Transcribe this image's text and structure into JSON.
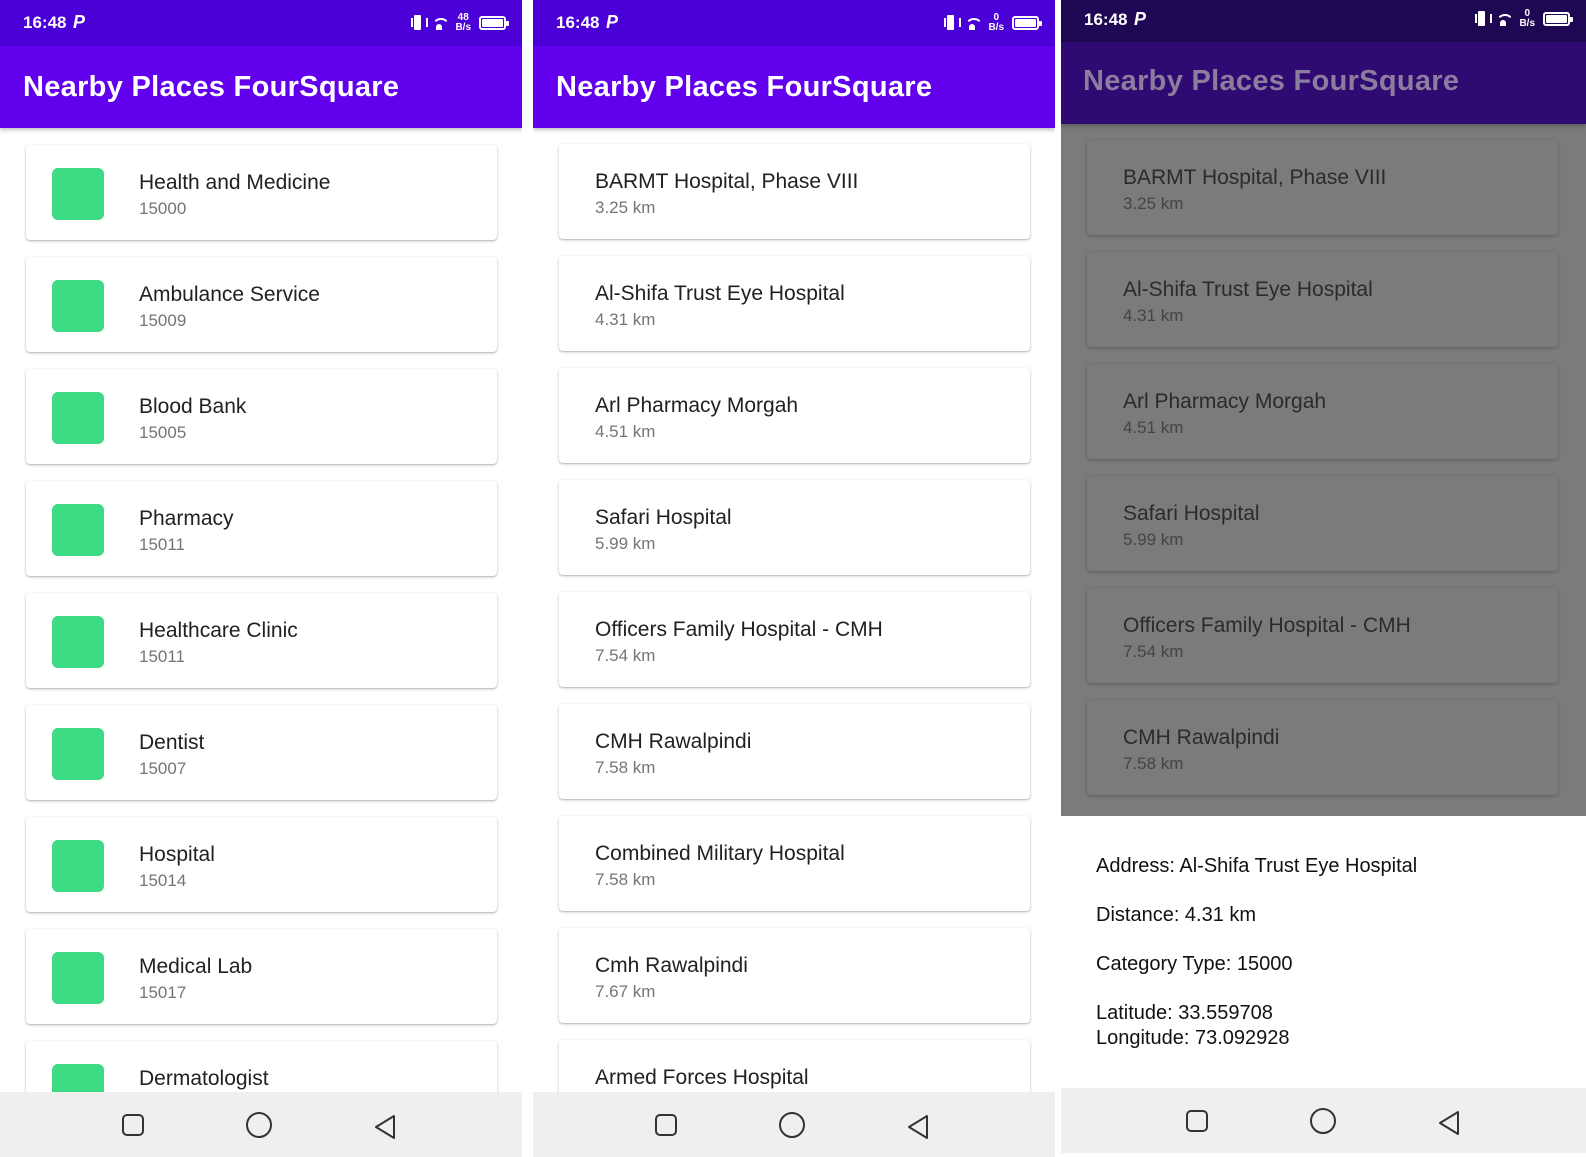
{
  "status_bar": {
    "time": "16:48",
    "carrier_glyph": "P",
    "screens": [
      {
        "net_top": "48",
        "net_bottom": "B/s"
      },
      {
        "net_top": "0",
        "net_bottom": "B/s"
      },
      {
        "net_top": "0",
        "net_bottom": "B/s"
      }
    ]
  },
  "app_title": "Nearby Places FourSquare",
  "categories": [
    {
      "name": "Health and Medicine",
      "code": "15000"
    },
    {
      "name": "Ambulance Service",
      "code": "15009"
    },
    {
      "name": "Blood Bank",
      "code": "15005"
    },
    {
      "name": "Pharmacy",
      "code": "15011"
    },
    {
      "name": "Healthcare Clinic",
      "code": "15011"
    },
    {
      "name": "Dentist",
      "code": "15007"
    },
    {
      "name": "Hospital",
      "code": "15014"
    },
    {
      "name": "Medical Lab",
      "code": "15017"
    },
    {
      "name": "Dermatologist",
      "code": ""
    }
  ],
  "places": [
    {
      "name": "BARMT Hospital, Phase VIII",
      "distance": "3.25 km"
    },
    {
      "name": "Al-Shifa Trust Eye Hospital",
      "distance": "4.31 km"
    },
    {
      "name": "Arl Pharmacy Morgah",
      "distance": "4.51 km"
    },
    {
      "name": "Safari Hospital",
      "distance": "5.99 km"
    },
    {
      "name": "Officers Family Hospital - CMH",
      "distance": "7.54 km"
    },
    {
      "name": "CMH Rawalpindi",
      "distance": "7.58 km"
    },
    {
      "name": "Combined Military Hospital",
      "distance": "7.58 km"
    },
    {
      "name": "Cmh Rawalpindi",
      "distance": "7.67 km"
    },
    {
      "name": "Armed Forces Hospital",
      "distance": ""
    }
  ],
  "detail_sheet": {
    "address": "Address: Al-Shifa Trust Eye Hospital",
    "distance": "Distance: 4.31 km",
    "category_type": "Category Type: 15000",
    "latitude": "Latitude: 33.559708",
    "longitude": "Longitude: 73.092928"
  },
  "icons": {
    "category_thumb_color": "#3DDC84",
    "nav_buttons": [
      "recents-square-icon",
      "home-circle-icon",
      "back-triangle-icon"
    ]
  },
  "colors": {
    "app_bar": "#6200EE",
    "status_bar": "#4A00D7",
    "scrim_app_bar": "#2F0A72",
    "scrim_list": "#7B7B7B"
  }
}
